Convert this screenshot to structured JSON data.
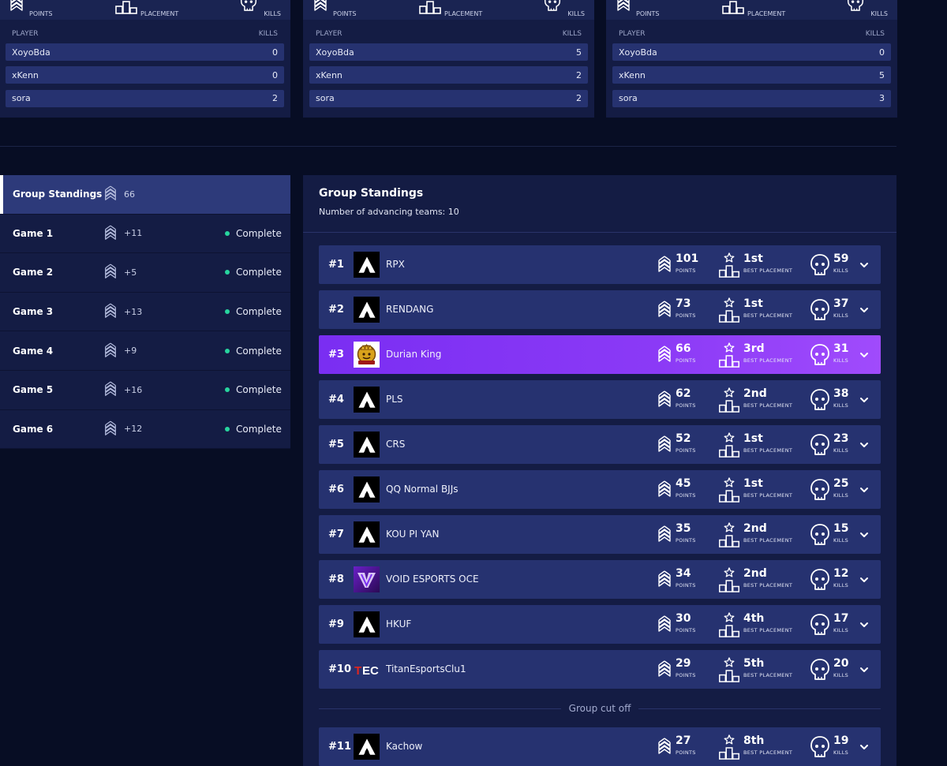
{
  "cards": [
    {
      "header": {
        "points": "POINTS",
        "placement": "PLACEMENT",
        "kills": "KILLS"
      },
      "col_player": "PLAYER",
      "col_kills": "KILLS",
      "players": [
        {
          "name": "XoyoBda",
          "kills": "0"
        },
        {
          "name": "xKenn",
          "kills": "0"
        },
        {
          "name": "sora",
          "kills": "2"
        }
      ]
    },
    {
      "header": {
        "points": "POINTS",
        "placement": "PLACEMENT",
        "kills": "KILLS"
      },
      "col_player": "PLAYER",
      "col_kills": "KILLS",
      "players": [
        {
          "name": "XoyoBda",
          "kills": "5"
        },
        {
          "name": "xKenn",
          "kills": "2"
        },
        {
          "name": "sora",
          "kills": "2"
        }
      ]
    },
    {
      "header": {
        "points": "POINTS",
        "placement": "PLACEMENT",
        "kills": "KILLS"
      },
      "col_player": "PLAYER",
      "col_kills": "KILLS",
      "players": [
        {
          "name": "XoyoBda",
          "kills": "0"
        },
        {
          "name": "xKenn",
          "kills": "5"
        },
        {
          "name": "sora",
          "kills": "3"
        }
      ]
    }
  ],
  "sidebar": {
    "items": [
      {
        "label": "Group Standings",
        "points": "66",
        "status": "",
        "active": true
      },
      {
        "label": "Game 1",
        "points": "+11",
        "status": "Complete",
        "active": false
      },
      {
        "label": "Game 2",
        "points": "+5",
        "status": "Complete",
        "active": false
      },
      {
        "label": "Game 3",
        "points": "+13",
        "status": "Complete",
        "active": false
      },
      {
        "label": "Game 4",
        "points": "+9",
        "status": "Complete",
        "active": false
      },
      {
        "label": "Game 5",
        "points": "+16",
        "status": "Complete",
        "active": false
      },
      {
        "label": "Game 6",
        "points": "+12",
        "status": "Complete",
        "active": false
      }
    ]
  },
  "main": {
    "title": "Group Standings",
    "subtitle": "Number of advancing teams: 10",
    "stat_labels": {
      "points": "POINTS",
      "placement": "BEST PLACEMENT",
      "kills": "KILLS"
    },
    "cutoff_label": "Group cut off",
    "teams": [
      {
        "rank": "#1",
        "name": "RPX",
        "points": "101",
        "placement": "1st",
        "kills": "59",
        "logo": "apex-logo",
        "highlight": false
      },
      {
        "rank": "#2",
        "name": "RENDANG",
        "points": "73",
        "placement": "1st",
        "kills": "37",
        "logo": "apex-logo",
        "highlight": false
      },
      {
        "rank": "#3",
        "name": "Durian King",
        "points": "66",
        "placement": "3rd",
        "kills": "31",
        "logo": "durian-king-logo",
        "highlight": true
      },
      {
        "rank": "#4",
        "name": "PLS",
        "points": "62",
        "placement": "2nd",
        "kills": "38",
        "logo": "apex-logo",
        "highlight": false
      },
      {
        "rank": "#5",
        "name": "CRS",
        "points": "52",
        "placement": "1st",
        "kills": "23",
        "logo": "apex-logo",
        "highlight": false
      },
      {
        "rank": "#6",
        "name": "QQ Normal BJJs",
        "points": "45",
        "placement": "1st",
        "kills": "25",
        "logo": "apex-logo",
        "highlight": false
      },
      {
        "rank": "#7",
        "name": "KOU PI YAN",
        "points": "35",
        "placement": "2nd",
        "kills": "15",
        "logo": "apex-logo",
        "highlight": false
      },
      {
        "rank": "#8",
        "name": "VOID ESPORTS OCE",
        "points": "34",
        "placement": "2nd",
        "kills": "12",
        "logo": "void-logo",
        "highlight": false
      },
      {
        "rank": "#9",
        "name": "HKUF",
        "points": "30",
        "placement": "4th",
        "kills": "17",
        "logo": "apex-logo",
        "highlight": false
      },
      {
        "rank": "#10",
        "name": "TitanEsportsClu1",
        "points": "29",
        "placement": "5th",
        "kills": "20",
        "logo": "tec-logo",
        "highlight": false
      },
      {
        "rank": "#11",
        "name": "Kachow",
        "points": "27",
        "placement": "8th",
        "kills": "19",
        "logo": "apex-logo",
        "highlight": false
      }
    ]
  },
  "colors": {
    "highlight": "#8b3af6",
    "status_dot": "#27d59e",
    "row": "#263270",
    "panel": "#141c44",
    "background": "#070d24"
  }
}
